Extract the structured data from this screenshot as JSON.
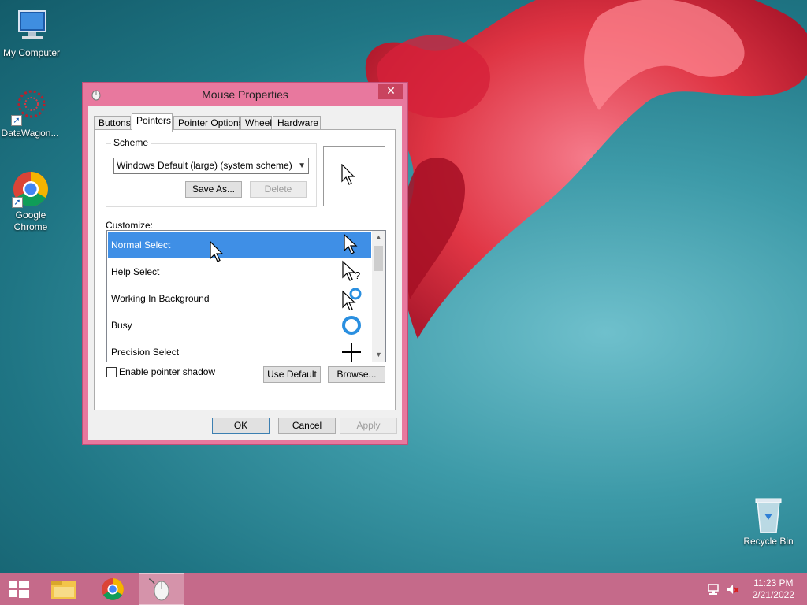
{
  "desktop": {
    "icons": [
      {
        "label": "My Computer",
        "icon": "computer-icon"
      },
      {
        "label": "DataWagon...",
        "icon": "datawagon-icon"
      },
      {
        "label": "Google Chrome",
        "icon": "chrome-icon"
      },
      {
        "label": "Recycle Bin",
        "icon": "recycle-bin-icon"
      }
    ]
  },
  "dialog": {
    "title": "Mouse Properties",
    "close": "✕",
    "tabs": [
      {
        "label": "Buttons"
      },
      {
        "label": "Pointers"
      },
      {
        "label": "Pointer Options"
      },
      {
        "label": "Wheel"
      },
      {
        "label": "Hardware"
      }
    ],
    "active_tab": "Pointers",
    "scheme": {
      "group_label": "Scheme",
      "selected": "Windows Default (large) (system scheme)",
      "save_as": "Save As...",
      "delete": "Delete"
    },
    "customize": {
      "label": "Customize:",
      "items": [
        {
          "label": "Normal Select",
          "icon": "arrow-cursor-icon",
          "selected": true
        },
        {
          "label": "Help Select",
          "icon": "help-cursor-icon"
        },
        {
          "label": "Working In Background",
          "icon": "working-cursor-icon"
        },
        {
          "label": "Busy",
          "icon": "busy-cursor-icon"
        },
        {
          "label": "Precision Select",
          "icon": "crosshair-cursor-icon"
        }
      ]
    },
    "shadow": {
      "label": "Enable pointer shadow",
      "checked": false
    },
    "use_default": "Use Default",
    "browse": "Browse...",
    "ok": "OK",
    "cancel": "Cancel",
    "apply": "Apply"
  },
  "taskbar": {
    "apps": [
      {
        "icon": "file-explorer-icon"
      },
      {
        "icon": "chrome-icon"
      },
      {
        "icon": "mouse-icon",
        "active": true
      }
    ],
    "time": "11:23 PM",
    "date": "2/21/2022"
  },
  "colors": {
    "accent": "#e8789e",
    "selection": "#3f8fe6",
    "taskbar": "#c56a8a"
  }
}
